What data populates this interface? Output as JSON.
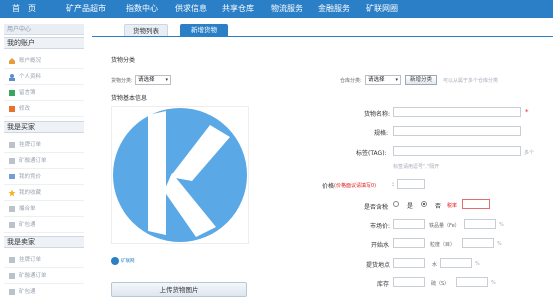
{
  "nav": {
    "items": [
      "首　页",
      "矿产品超市",
      "指数中心",
      "供求信息",
      "共享仓库",
      "物流服务",
      "金融服务",
      "矿联网圈"
    ]
  },
  "sidebar": {
    "header": "用户中心",
    "account_title": "我的账户",
    "account_items": [
      "账户概况",
      "个人资料",
      "留言簿",
      "修改"
    ],
    "buyer_title": "我是买家",
    "buyer_items": [
      "挂牌订单",
      "矿融通订单",
      "我的竞价",
      "我的收藏",
      "撮合单",
      "矿包通"
    ],
    "seller_title": "我是卖家",
    "seller_items": [
      "挂牌订单",
      "矿融通订单",
      "矿包通"
    ]
  },
  "tabs": {
    "list": "货物列表",
    "add": "新增货物"
  },
  "form": {
    "category_section": "货物分类",
    "goods_category_label": "货物分类:",
    "goods_category_value": "请选择",
    "warehouse_category_label": "仓库分类:",
    "warehouse_category_value": "请选择",
    "add_category_button": "新增分类",
    "warehouse_hint": "可以从属于多个仓库分类",
    "basic_section": "货物基本信息",
    "name_label": "货物名称:",
    "spec_label": "规格:",
    "tag_label": "标签(TAG):",
    "tag_hint": "多个",
    "tag_example": "标签请用逗号\",\"隔开",
    "price_label": "价格",
    "price_note": "(价格面议请填写0)",
    "price_colon": ":",
    "tax_label": "是否含税",
    "tax_yes": "是",
    "tax_no": "否",
    "tax_rate_label": "税率",
    "market_label": "市场价:",
    "iron_label": "铁品量（Fe）",
    "percent": "%",
    "opening_label": "开始水",
    "water_label": "粒度（目）",
    "delivery_label": "提货地点",
    "water2_label": "水",
    "stock_label": "库存",
    "sulfur_label": "硫（S）",
    "upload_button": "上传货物图片",
    "logo_text": "矿联网"
  },
  "colors": {
    "brand_blue": "#2a7fc7",
    "logo_blue": "#5aa9e6",
    "required_red": "#e02020"
  }
}
